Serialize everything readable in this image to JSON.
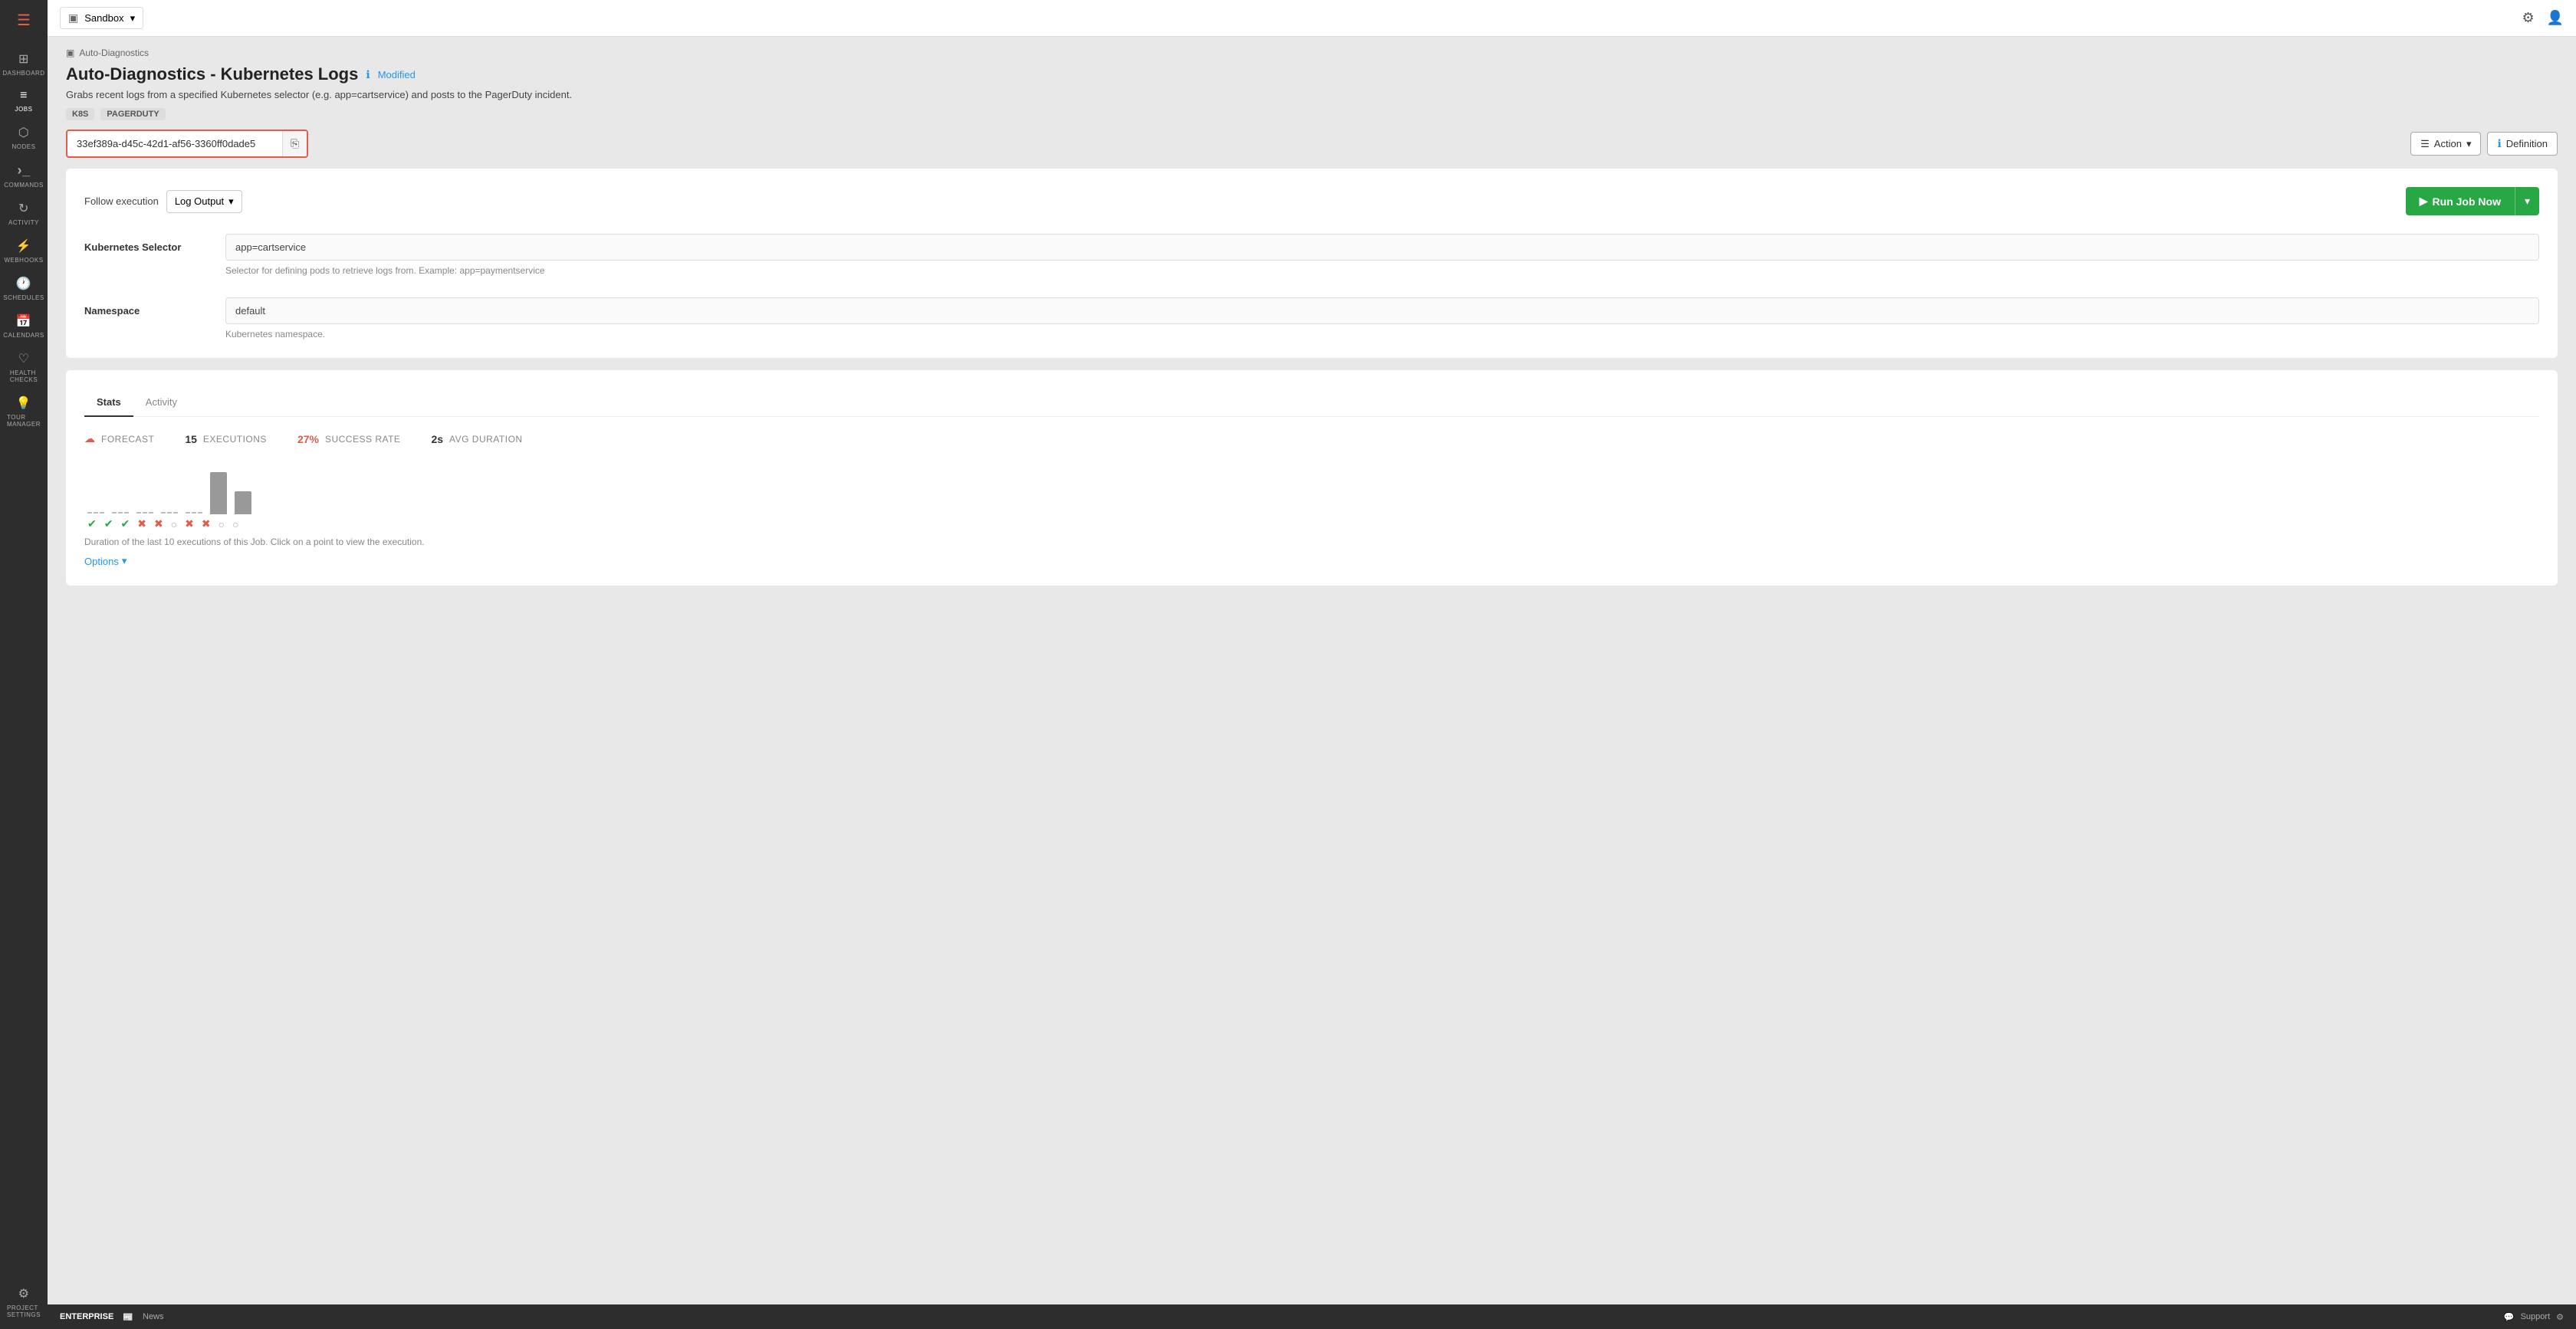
{
  "sidebar": {
    "hamburger": "☰",
    "items": [
      {
        "id": "dashboard",
        "icon": "⊞",
        "label": "Dashboard"
      },
      {
        "id": "jobs",
        "icon": "≡",
        "label": "Jobs",
        "active": true
      },
      {
        "id": "nodes",
        "icon": "⬡",
        "label": "Nodes"
      },
      {
        "id": "commands",
        "icon": "›",
        "label": "Commands"
      },
      {
        "id": "activity",
        "icon": "↻",
        "label": "Activity"
      },
      {
        "id": "webhooks",
        "icon": "⚡",
        "label": "Webhooks"
      },
      {
        "id": "schedules",
        "icon": "🕐",
        "label": "Schedules"
      },
      {
        "id": "calendars",
        "icon": "📅",
        "label": "Calendars"
      },
      {
        "id": "health-checks",
        "icon": "♡",
        "label": "Health Checks"
      },
      {
        "id": "tour-manager",
        "icon": "💡",
        "label": "Tour Manager"
      }
    ],
    "bottom": [
      {
        "id": "project-settings",
        "icon": "⚙",
        "label": "Project Settings"
      }
    ]
  },
  "topbar": {
    "project_icon": "▣",
    "project_name": "Sandbox",
    "dropdown_icon": "▾",
    "settings_icon": "⚙",
    "user_icon": "👤"
  },
  "breadcrumb": {
    "icon": "▣",
    "text": "Auto-Diagnostics"
  },
  "header": {
    "title": "Auto-Diagnostics - Kubernetes Logs",
    "info_icon": "ℹ",
    "modified_label": "Modified",
    "description": "Grabs recent logs from a specified Kubernetes selector (e.g. app=cartservice) and posts to the PagerDuty incident.",
    "tags": [
      "K8S",
      "PAGERDUTY"
    ],
    "uuid": "33ef389a-d45c-42d1-af56-3360ff0dade5",
    "copy_icon": "⎘",
    "action_btn": {
      "icon": "☰",
      "label": "Action",
      "dropdown": "▾"
    },
    "definition_btn": {
      "icon": "ℹ",
      "label": "Definition"
    }
  },
  "execution": {
    "follow_label": "Follow execution",
    "follow_value": "Log Output",
    "follow_dropdown": "▾",
    "run_icon": "▶",
    "run_label": "Run Job Now",
    "run_dropdown": "▾"
  },
  "fields": [
    {
      "label": "Kubernetes Selector",
      "value": "app=cartservice",
      "hint": "Selector for defining pods to retrieve logs from. Example: app=paymentservice"
    },
    {
      "label": "Namespace",
      "value": "default",
      "hint": "Kubernetes namespace."
    }
  ],
  "stats": {
    "tabs": [
      "Stats",
      "Activity"
    ],
    "active_tab": "Stats",
    "forecast_icon": "☁",
    "forecast_label": "FORECAST",
    "executions_count": "15",
    "executions_label": "EXECUTIONS",
    "success_rate_value": "27%",
    "success_rate_label": "SUCCESS RATE",
    "avg_duration_value": "2s",
    "avg_duration_label": "AVG DURATION",
    "bars": [
      {
        "type": "dash",
        "height": 0
      },
      {
        "type": "dash",
        "height": 0
      },
      {
        "type": "dash",
        "height": 0
      },
      {
        "type": "dash",
        "height": 0
      },
      {
        "type": "dash",
        "height": 0
      },
      {
        "type": "bar",
        "height": 55
      },
      {
        "type": "bar",
        "height": 30
      }
    ],
    "execution_icons": [
      "success",
      "success",
      "success",
      "fail",
      "fail",
      "neutral",
      "fail",
      "fail",
      "neutral",
      "neutral"
    ],
    "chart_description": "Duration of the last 10 executions of this Job. Click on a point to view the execution.",
    "options_label": "Options",
    "options_dropdown": "▾"
  },
  "bottom_bar": {
    "enterprise_label": "ENTERPRISE",
    "news_icon": "📰",
    "news_label": "News",
    "support_icon": "💬",
    "support_label": "Support",
    "settings_icon": "⚙"
  }
}
